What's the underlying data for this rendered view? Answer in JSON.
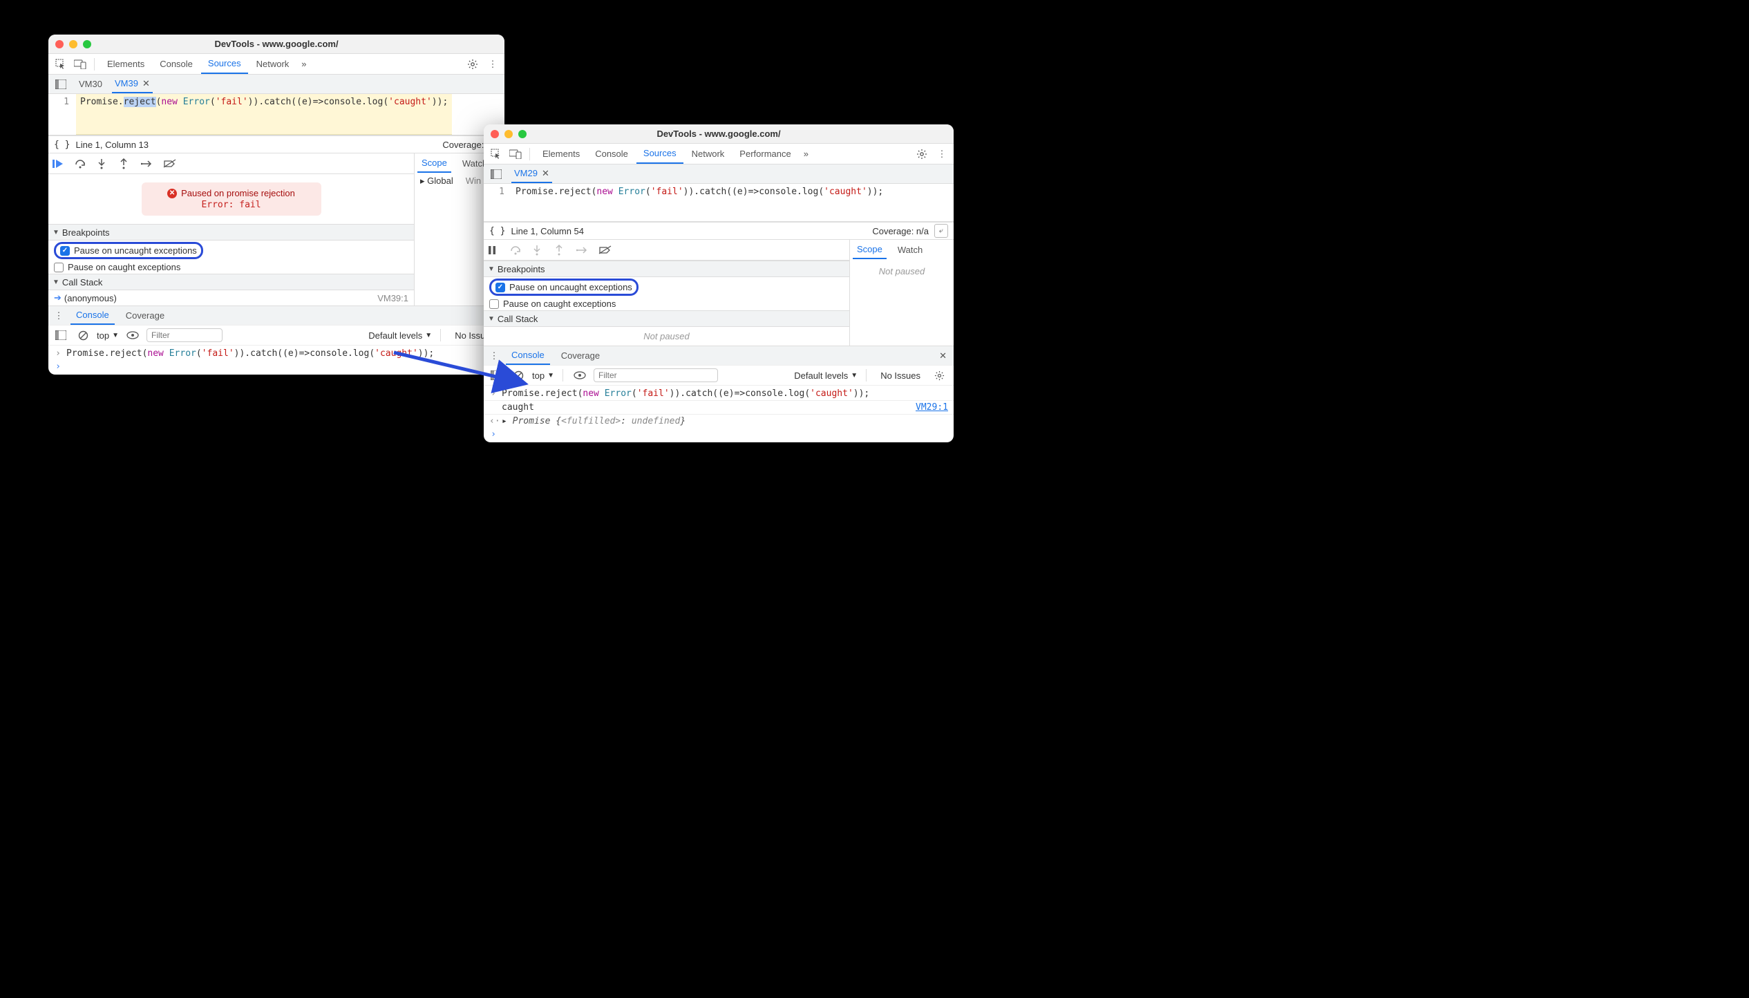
{
  "left": {
    "title": "DevTools - www.google.com/",
    "topTabs": [
      "Elements",
      "Console",
      "Sources",
      "Network"
    ],
    "topActive": "Sources",
    "fileTabs": [
      {
        "name": "VM30",
        "active": false,
        "closable": false
      },
      {
        "name": "VM39",
        "active": true,
        "closable": true
      }
    ],
    "code": {
      "lineNum": "1",
      "pre": "Promise.",
      "selected": "reject",
      "post1": "(",
      "kw": "new",
      "post2": " ",
      "cls": "Error",
      "post3": "(",
      "str1": "'fail'",
      "post4": ")).catch((e)=>console.log(",
      "str2": "'caught'",
      "post5": "));"
    },
    "status": {
      "left": "Line 1, Column 13",
      "right": "Coverage: n/a"
    },
    "pauseBanner": {
      "line1": "Paused on promise rejection",
      "line2": "Error: fail"
    },
    "scopeTabs": [
      "Scope",
      "Watch"
    ],
    "scopeActive": "Scope",
    "scopeRow": {
      "k": "Global",
      "v": "Win"
    },
    "breakpoints": {
      "title": "Breakpoints",
      "items": [
        {
          "label": "Pause on uncaught exceptions",
          "checked": true,
          "ring": true
        },
        {
          "label": "Pause on caught exceptions",
          "checked": false,
          "ring": false
        }
      ]
    },
    "callStack": {
      "title": "Call Stack",
      "frame": "(anonymous)",
      "loc": "VM39:1"
    },
    "drawerTabs": [
      "Console",
      "Coverage"
    ],
    "drawerActive": "Console",
    "console": {
      "context": "top",
      "filterPlaceholder": "Filter",
      "levels": "Default levels",
      "issues": "No Issues",
      "rows": [
        {
          "type": "input",
          "pre": "Promise.reject(",
          "kw": "new",
          "mid": " ",
          "cls": "Error",
          "p2": "(",
          "s1": "'fail'",
          "p3": ")).catch((e)=>console.log(",
          "s2": "'caught'",
          "p4": "));"
        },
        {
          "type": "prompt"
        }
      ]
    }
  },
  "right": {
    "title": "DevTools - www.google.com/",
    "topTabs": [
      "Elements",
      "Console",
      "Sources",
      "Network",
      "Performance"
    ],
    "topActive": "Sources",
    "fileTabs": [
      {
        "name": "VM29",
        "active": true,
        "closable": true
      }
    ],
    "code": {
      "lineNum": "1",
      "pre": "Promise.reject(",
      "kw": "new",
      "mid": " ",
      "cls": "Error",
      "p2": "(",
      "str1": "'fail'",
      "p3": ")).catch((e)=>console.log(",
      "str2": "'caught'",
      "p4": "));"
    },
    "status": {
      "left": "Line 1, Column 54",
      "right": "Coverage: n/a"
    },
    "scopeTabs": [
      "Scope",
      "Watch"
    ],
    "scopeActive": "Scope",
    "scopeEmpty": "Not paused",
    "breakpoints": {
      "title": "Breakpoints",
      "items": [
        {
          "label": "Pause on uncaught exceptions",
          "checked": true,
          "ring": true
        },
        {
          "label": "Pause on caught exceptions",
          "checked": false,
          "ring": false
        }
      ]
    },
    "callStack": {
      "title": "Call Stack",
      "empty": "Not paused"
    },
    "drawerTabs": [
      "Console",
      "Coverage"
    ],
    "drawerActive": "Console",
    "console": {
      "context": "top",
      "filterPlaceholder": "Filter",
      "levels": "Default levels",
      "issues": "No Issues",
      "rows": [
        {
          "type": "input",
          "pre": "Promise.reject(",
          "kw": "new",
          "mid": " ",
          "cls": "Error",
          "p2": "(",
          "s1": "'fail'",
          "p3": ")).catch((e)=>console.log(",
          "s2": "'caught'",
          "p4": "));"
        },
        {
          "type": "log",
          "text": "caught",
          "link": "VM29:1"
        },
        {
          "type": "result",
          "text1": "Promise {",
          "k": "<fulfilled>",
          "text2": ": ",
          "v": "undefined",
          "text3": "}"
        },
        {
          "type": "prompt"
        }
      ]
    }
  }
}
